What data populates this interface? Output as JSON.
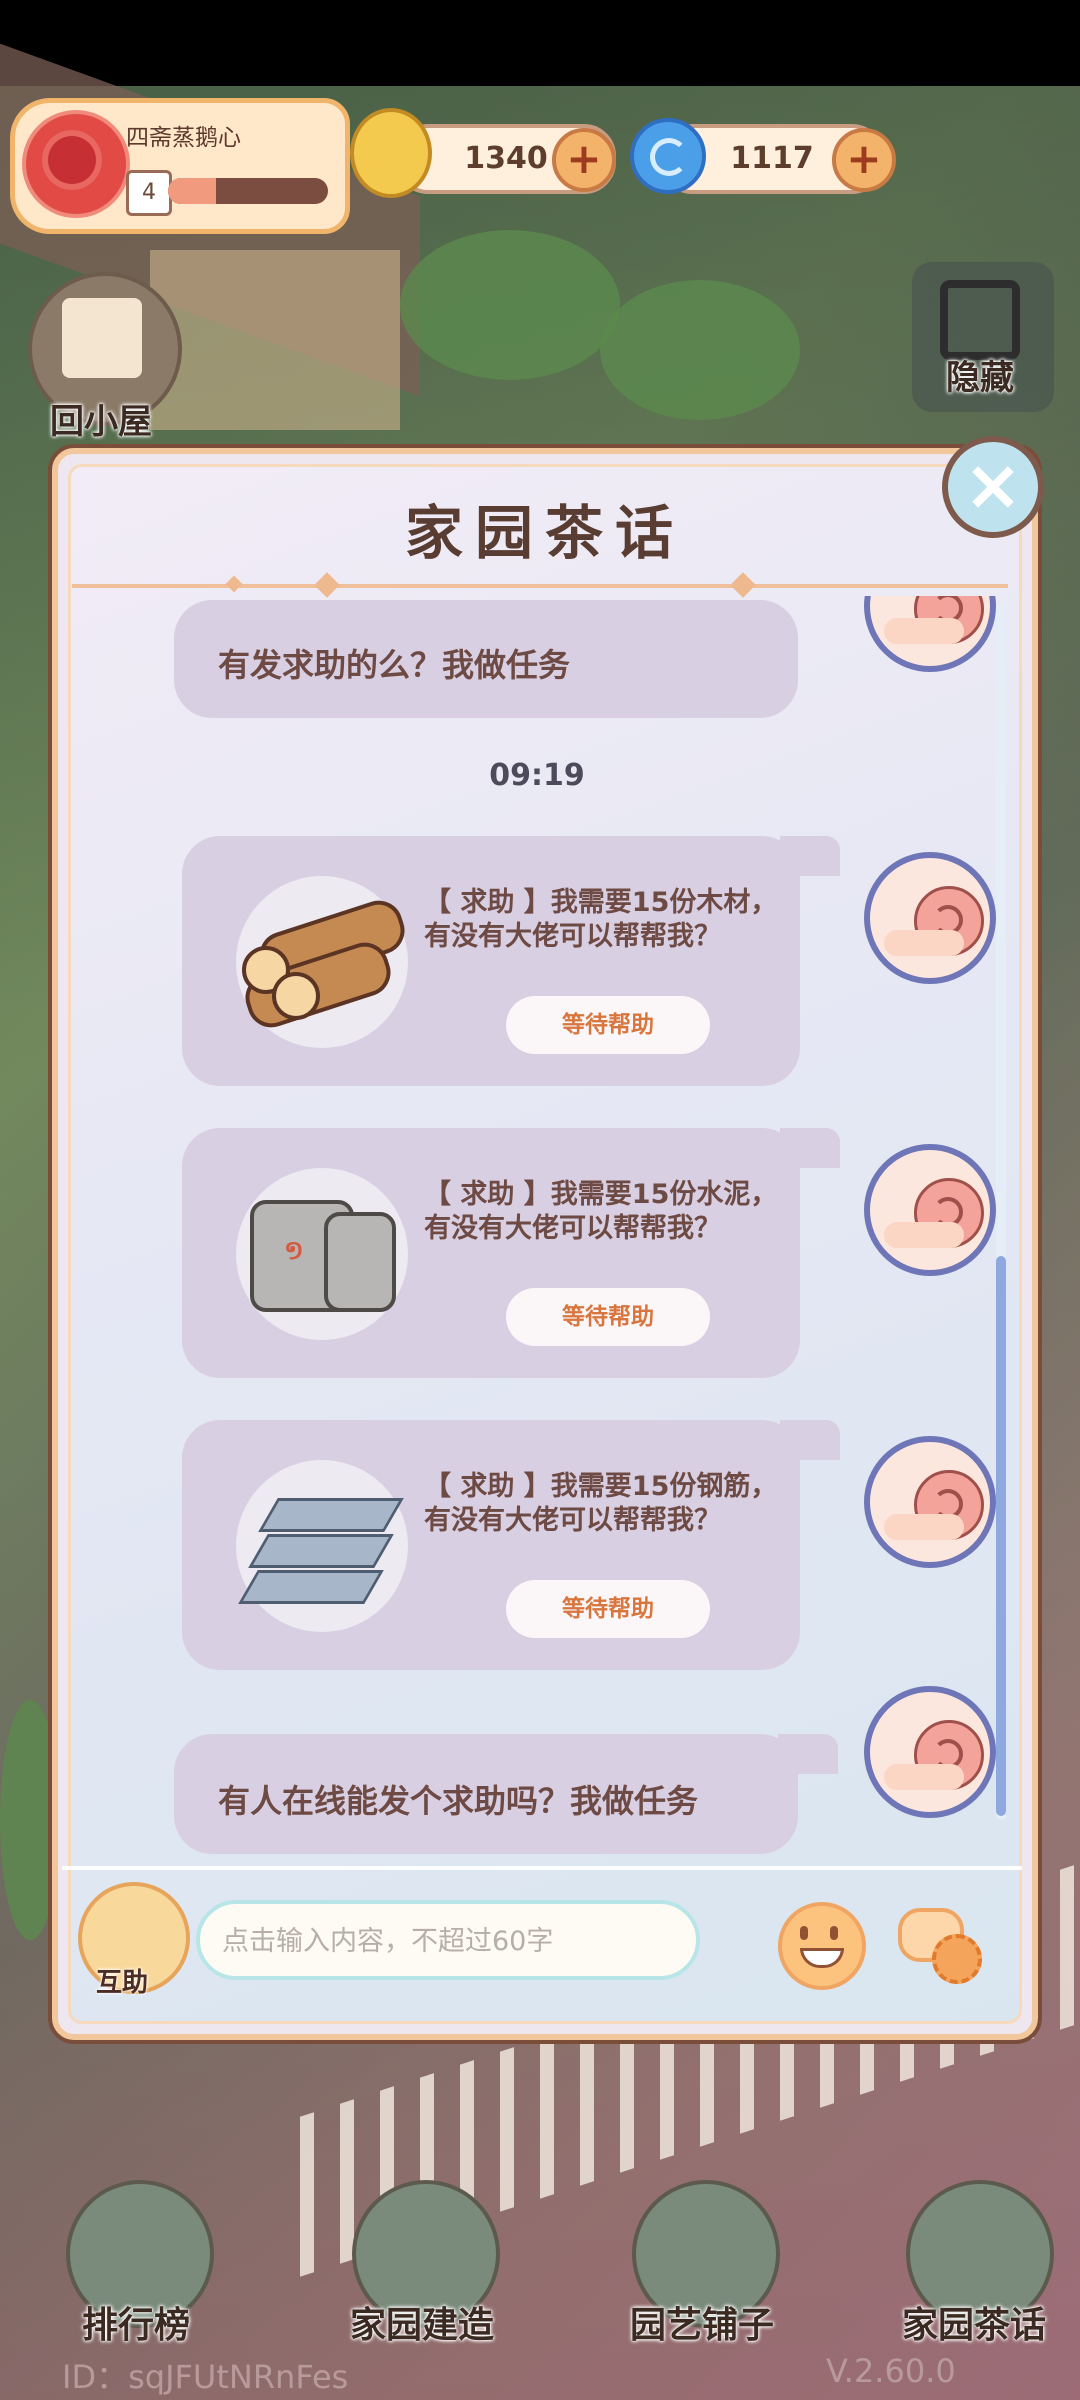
{
  "profile": {
    "name": "四斋蒸鹅心",
    "level": "4",
    "exp_fraction": 0.3
  },
  "currencies": {
    "snail_coin": "1340",
    "swirl_coin": "1117"
  },
  "side": {
    "home_label": "回小屋",
    "hide_label": "隐藏"
  },
  "dialog": {
    "title": "家园茶话",
    "messages": {
      "m1": "有发求助的么？我做任务",
      "time": "09:19",
      "req1": {
        "line1": "【 求助 】我需要15份木材，",
        "line2": "有没有大佬可以帮帮我？",
        "button": "等待帮助"
      },
      "req2": {
        "line1": "【 求助 】我需要15份水泥，",
        "line2": "有没有大佬可以帮帮我？",
        "button": "等待帮助"
      },
      "req3": {
        "line1": "【 求助 】我需要15份钢筋，",
        "line2": "有没有大佬可以帮帮我？",
        "button": "等待帮助"
      },
      "m2": "有人在线能发个求助吗？我做任务"
    },
    "input_placeholder": "点击输入内容，不超过60字",
    "help_label": "互助",
    "cement_mark": "១"
  },
  "nav": {
    "rank": "排行榜",
    "build": "家园建造",
    "shop": "园艺铺子",
    "tea": "家园茶话"
  },
  "footer": {
    "id": "ID：sqJFUtNRnFes",
    "version": "V.2.60.0"
  },
  "icons": {
    "close": "×",
    "plus": "+"
  },
  "colors": {
    "accent": "#f0b56a",
    "bubble": "#d9cfe2",
    "wait_text": "#d9763e"
  }
}
